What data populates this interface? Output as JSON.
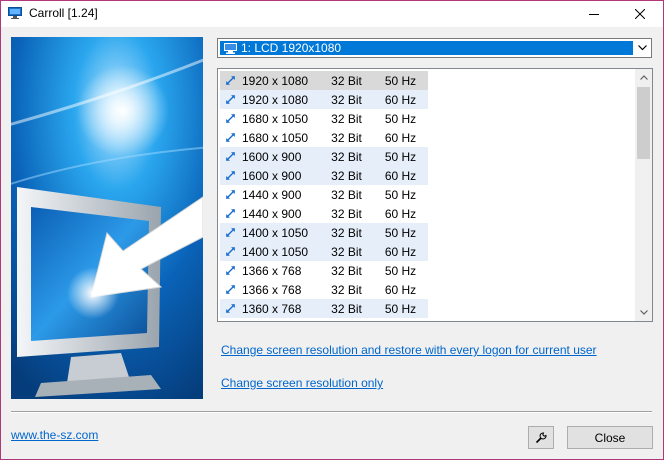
{
  "window": {
    "title": "Carroll [1.24]",
    "icon": "monitor-icon"
  },
  "monitor_select": {
    "value": "1: LCD 1920x1080",
    "icon": "display-icon"
  },
  "resolutions": [
    {
      "res": "1920 x 1080",
      "bits": "32 Bit",
      "hz": "50 Hz"
    },
    {
      "res": "1920 x 1080",
      "bits": "32 Bit",
      "hz": "60 Hz"
    },
    {
      "res": "1680 x 1050",
      "bits": "32 Bit",
      "hz": "50 Hz"
    },
    {
      "res": "1680 x 1050",
      "bits": "32 Bit",
      "hz": "60 Hz"
    },
    {
      "res": "1600 x 900",
      "bits": "32 Bit",
      "hz": "50 Hz"
    },
    {
      "res": "1600 x 900",
      "bits": "32 Bit",
      "hz": "60 Hz"
    },
    {
      "res": "1440 x 900",
      "bits": "32 Bit",
      "hz": "50 Hz"
    },
    {
      "res": "1440 x 900",
      "bits": "32 Bit",
      "hz": "60 Hz"
    },
    {
      "res": "1400 x 1050",
      "bits": "32 Bit",
      "hz": "50 Hz"
    },
    {
      "res": "1400 x 1050",
      "bits": "32 Bit",
      "hz": "60 Hz"
    },
    {
      "res": "1366 x 768",
      "bits": "32 Bit",
      "hz": "50 Hz"
    },
    {
      "res": "1366 x 768",
      "bits": "32 Bit",
      "hz": "60 Hz"
    },
    {
      "res": "1360 x 768",
      "bits": "32 Bit",
      "hz": "50 Hz"
    }
  ],
  "links": {
    "restore": "Change screen resolution and restore with every logon for current user",
    "only": "Change screen resolution only",
    "website": "www.the-sz.com"
  },
  "buttons": {
    "close": "Close",
    "settings_icon": "wrench-icon"
  },
  "colors": {
    "selection": "#0078d7",
    "link": "#0066cc",
    "row_band": "#e6eefa",
    "row_selected": "#d9d9d9",
    "window_border": "#b0377a"
  }
}
